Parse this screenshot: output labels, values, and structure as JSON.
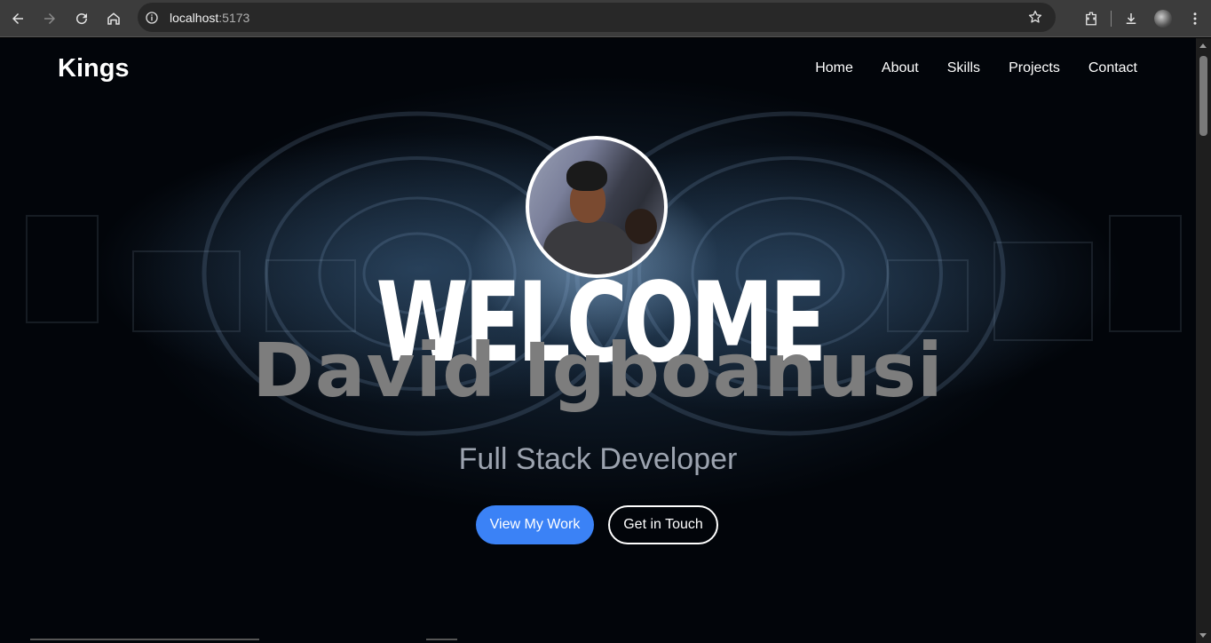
{
  "browser": {
    "url_host": "localhost",
    "url_port": ":5173"
  },
  "site": {
    "brand": "Kings",
    "nav": [
      "Home",
      "About",
      "Skills",
      "Projects",
      "Contact"
    ]
  },
  "hero": {
    "welcome": "WELCOME",
    "name": "David Igboanusi",
    "tagline": "Full Stack Developer",
    "primary_button": "View My Work",
    "secondary_button": "Get in Touch"
  },
  "colors": {
    "accent": "#3b82f6",
    "name_text": "#7d7d7d",
    "tagline_text": "#9ca3af"
  }
}
